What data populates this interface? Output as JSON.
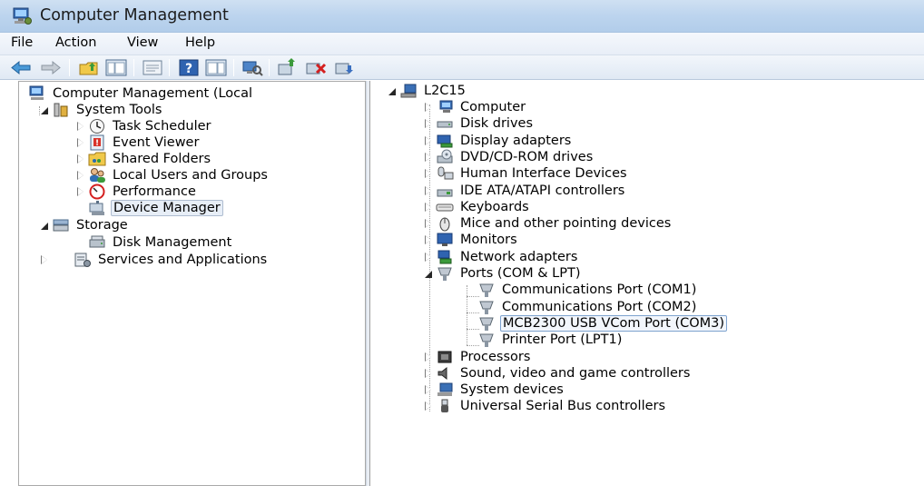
{
  "window": {
    "title": "Computer Management",
    "icon": "computer-management-icon"
  },
  "menu": [
    "File",
    "Action",
    "View",
    "Help"
  ],
  "toolbar": [
    "back-arrow-icon",
    "forward-arrow-icon",
    "up-folder-icon",
    "show-hide-console-tree-icon",
    "properties-icon",
    "help-icon",
    "show-hide-action-pane-icon",
    "scan-hardware-changes-icon",
    "update-driver-icon",
    "disable-device-icon",
    "uninstall-device-icon"
  ],
  "left_tree": {
    "root": "Computer Management (Local",
    "items": [
      {
        "label": "System Tools",
        "icon": "system-tools-icon",
        "state": "expanded"
      },
      {
        "label": "Task Scheduler",
        "icon": "clock-icon",
        "state": "collapsed"
      },
      {
        "label": "Event Viewer",
        "icon": "event-viewer-icon",
        "state": "collapsed"
      },
      {
        "label": "Shared Folders",
        "icon": "shared-folder-icon",
        "state": "collapsed"
      },
      {
        "label": "Local Users and Groups",
        "icon": "users-icon",
        "state": "collapsed"
      },
      {
        "label": "Performance",
        "icon": "performance-icon",
        "state": "collapsed"
      },
      {
        "label": "Device Manager",
        "icon": "device-manager-icon",
        "state": "leaf",
        "selected": true
      },
      {
        "label": "Storage",
        "icon": "storage-icon",
        "state": "expanded"
      },
      {
        "label": "Disk Management",
        "icon": "disk-management-icon",
        "state": "leaf"
      },
      {
        "label": "Services and Applications",
        "icon": "services-icon",
        "state": "collapsed"
      }
    ]
  },
  "device_tree": {
    "root": "L2C15",
    "categories": [
      {
        "label": "Computer",
        "icon": "computer-icon"
      },
      {
        "label": "Disk drives",
        "icon": "disk-drive-icon"
      },
      {
        "label": "Display adapters",
        "icon": "display-adapter-icon"
      },
      {
        "label": "DVD/CD-ROM drives",
        "icon": "dvd-drive-icon"
      },
      {
        "label": "Human Interface Devices",
        "icon": "hid-icon"
      },
      {
        "label": "IDE ATA/ATAPI controllers",
        "icon": "ide-controller-icon"
      },
      {
        "label": "Keyboards",
        "icon": "keyboard-icon"
      },
      {
        "label": "Mice and other pointing devices",
        "icon": "mouse-icon"
      },
      {
        "label": "Monitors",
        "icon": "monitor-icon"
      },
      {
        "label": "Network adapters",
        "icon": "network-adapter-icon"
      },
      {
        "label": "Ports (COM & LPT)",
        "icon": "port-icon",
        "expanded": true
      },
      {
        "label": "Processors",
        "icon": "processor-icon"
      },
      {
        "label": "Sound, video and game controllers",
        "icon": "sound-icon"
      },
      {
        "label": "System devices",
        "icon": "system-devices-icon"
      },
      {
        "label": "Universal Serial Bus controllers",
        "icon": "usb-icon"
      }
    ],
    "ports": [
      "Communications Port (COM1)",
      "Communications Port (COM2)",
      "MCB2300 USB VCom Port (COM3)",
      "Printer Port (LPT1)"
    ],
    "selected_port": "MCB2300 USB VCom Port (COM3)"
  }
}
